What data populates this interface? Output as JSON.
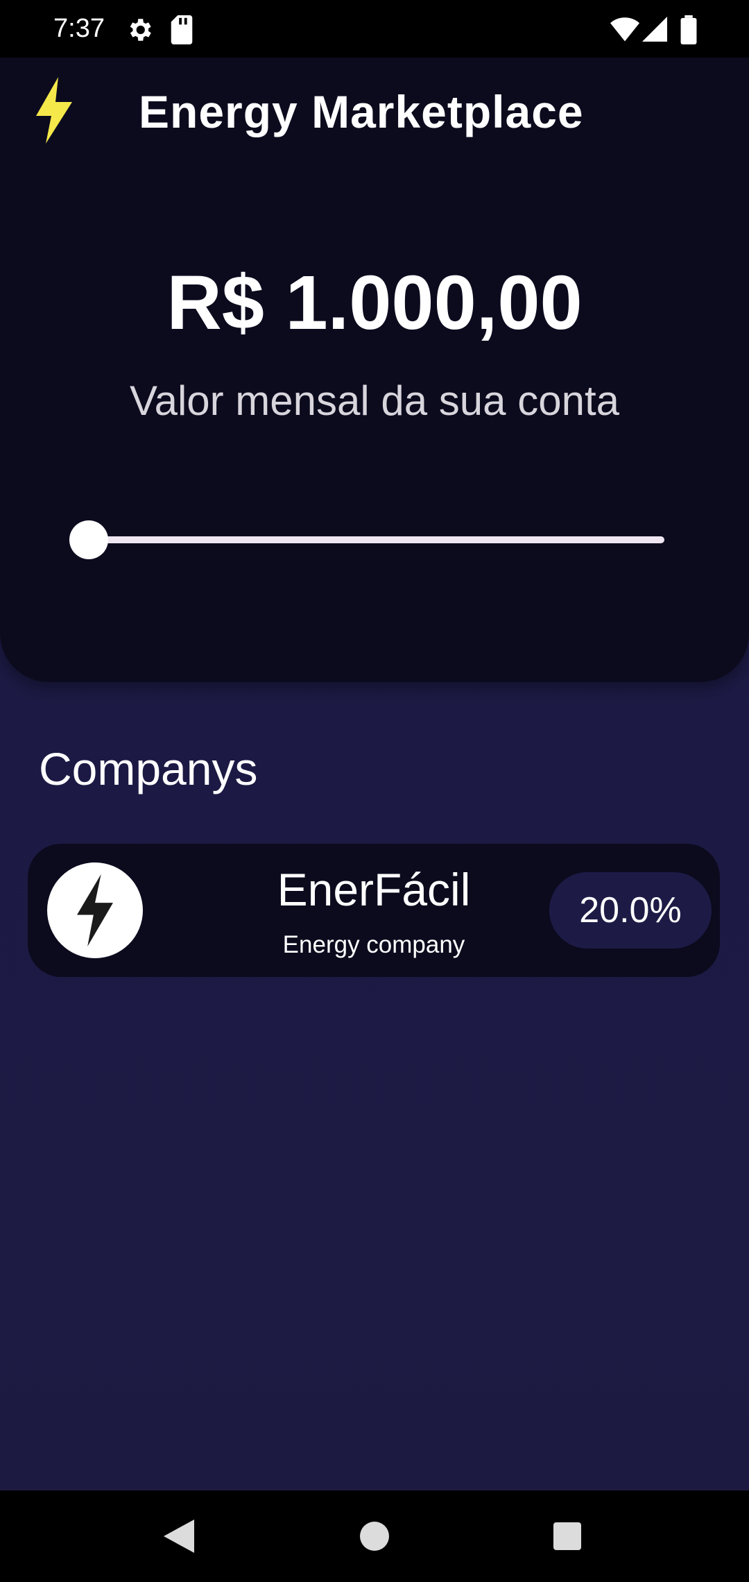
{
  "status_bar": {
    "time": "7:37",
    "icons": [
      "gear-icon",
      "sd-card-icon",
      "wifi-icon",
      "signal-icon",
      "battery-icon"
    ]
  },
  "app_bar": {
    "title": "Energy Marketplace",
    "logo_icon": "lightning-bolt-icon",
    "logo_color": "#f5e84a"
  },
  "bill": {
    "amount": "R$ 1.000,00",
    "caption": "Valor mensal da sua conta",
    "slider_value_fraction": 0.0
  },
  "companies": {
    "section_title": "Companys",
    "items": [
      {
        "icon": "lightning-bolt-icon",
        "name": "EnerFácil",
        "subtitle": "Energy company",
        "discount": "20.0%"
      }
    ]
  },
  "nav_bar": {
    "buttons": [
      "back-icon",
      "home-icon",
      "recents-icon"
    ]
  },
  "colors": {
    "background": "#1c1b47",
    "panel": "#0c0b1e",
    "accent": "#f5e84a",
    "badge": "#1d1b46"
  }
}
